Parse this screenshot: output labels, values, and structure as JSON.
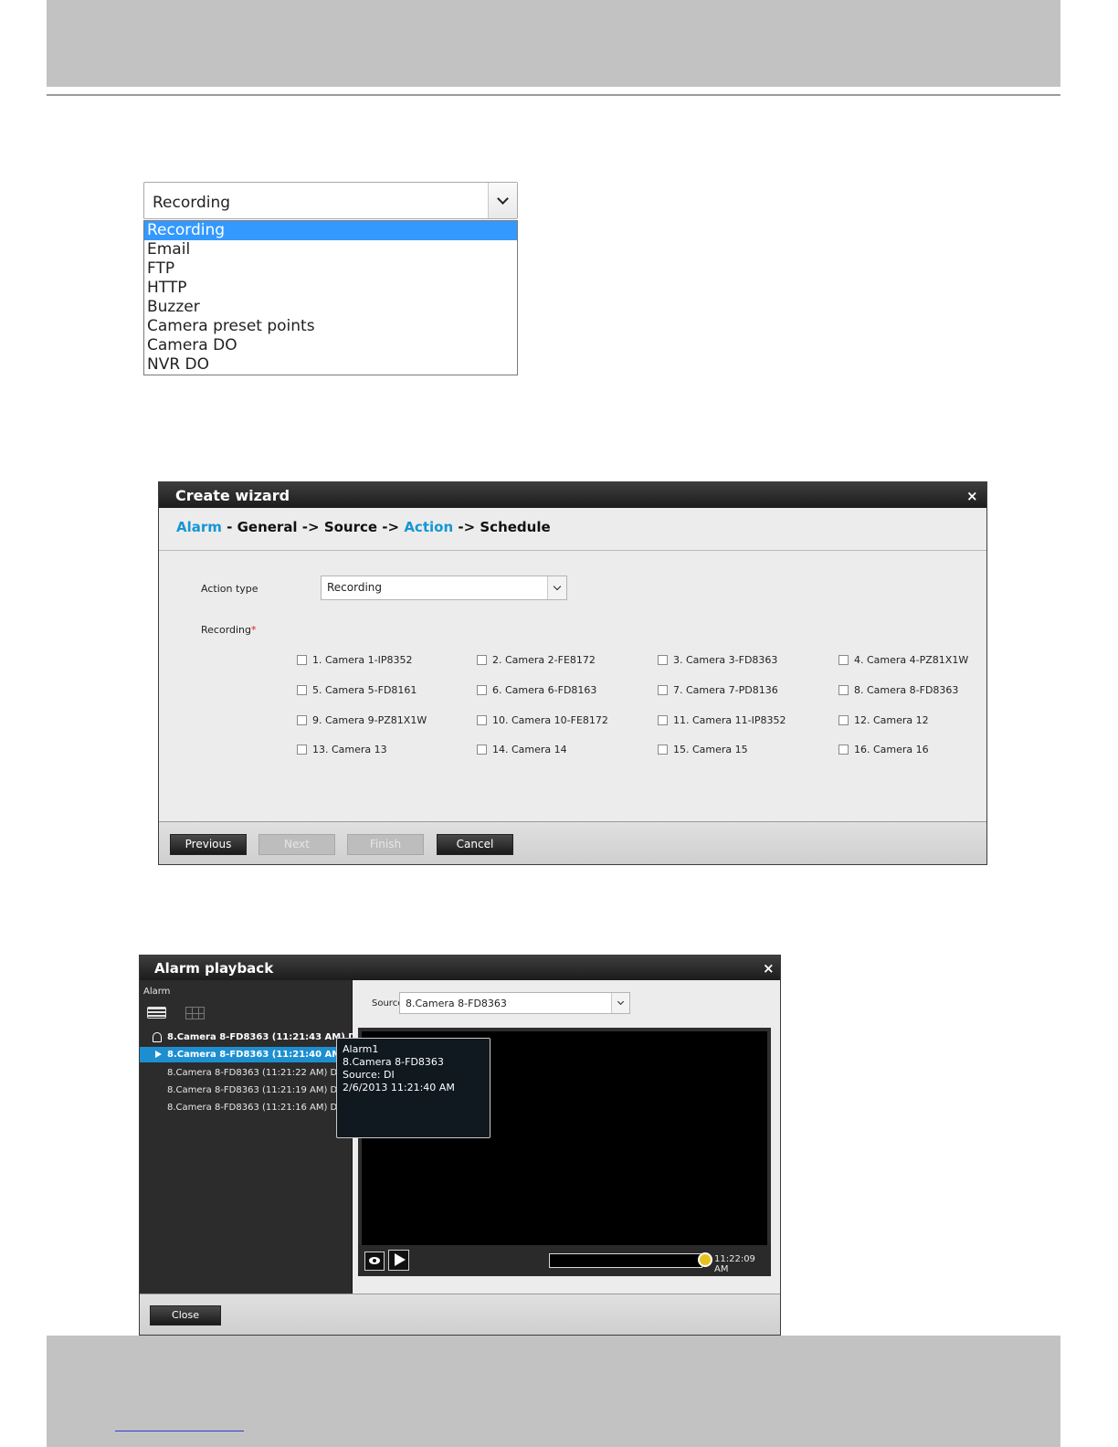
{
  "dropdown": {
    "selected": "Recording",
    "options": [
      "Recording",
      "Email",
      "FTP",
      "HTTP",
      "Buzzer",
      "Camera preset points",
      "Camera DO",
      "NVR DO"
    ],
    "highlighted_index": 0
  },
  "wizard": {
    "title": "Create wizard",
    "close": "×",
    "steps": [
      {
        "text": "Alarm",
        "highlight": true
      },
      {
        "text": " - ",
        "highlight": false
      },
      {
        "text": "General",
        "highlight": false
      },
      {
        "text": " -> ",
        "highlight": false
      },
      {
        "text": "Source",
        "highlight": false
      },
      {
        "text": " -> ",
        "highlight": false
      },
      {
        "text": "Action",
        "highlight": true
      },
      {
        "text": " -> ",
        "highlight": false
      },
      {
        "text": "Schedule",
        "highlight": false
      }
    ],
    "action_type_label": "Action type",
    "action_type_value": "Recording",
    "recording_label": "Recording",
    "required_mark": "*",
    "cameras": [
      "1. Camera 1-IP8352",
      "2. Camera 2-FE8172",
      "3. Camera 3-FD8363",
      "4. Camera 4-PZ81X1W",
      "5. Camera 5-FD8161",
      "6. Camera 6-FD8163",
      "7. Camera 7-PD8136",
      "8. Camera 8-FD8363",
      "9. Camera 9-PZ81X1W",
      "10. Camera 10-FE8172",
      "11. Camera 11-IP8352",
      "12. Camera 12",
      "13. Camera 13",
      "14. Camera 14",
      "15. Camera 15",
      "16. Camera 16"
    ],
    "buttons": {
      "previous": "Previous",
      "next": "Next",
      "finish": "Finish",
      "cancel": "Cancel"
    }
  },
  "playback": {
    "title": "Alarm playback",
    "close": "×",
    "alarm_label": "Alarm",
    "events": [
      {
        "text": "8.Camera 8-FD8363 (11:21:43 AM) DI",
        "state": "bold"
      },
      {
        "text": "8.Camera 8-FD8363 (11:21:40 AM) DI",
        "state": "selected"
      },
      {
        "text": "8.Camera 8-FD8363 (11:21:22 AM) DI",
        "state": "normal"
      },
      {
        "text": "8.Camera 8-FD8363 (11:21:19 AM) DI",
        "state": "normal"
      },
      {
        "text": "8.Camera 8-FD8363 (11:21:16 AM) DI",
        "state": "normal"
      }
    ],
    "source_label": "Source",
    "source_value": "8.Camera 8-FD8363",
    "tooltip": [
      "Alarm1",
      "8.Camera 8-FD8363",
      "Source: DI",
      "2/6/2013 11:21:40 AM"
    ],
    "time": "11:22:09 AM",
    "seek_progress": 1.0,
    "close_button": "Close"
  }
}
